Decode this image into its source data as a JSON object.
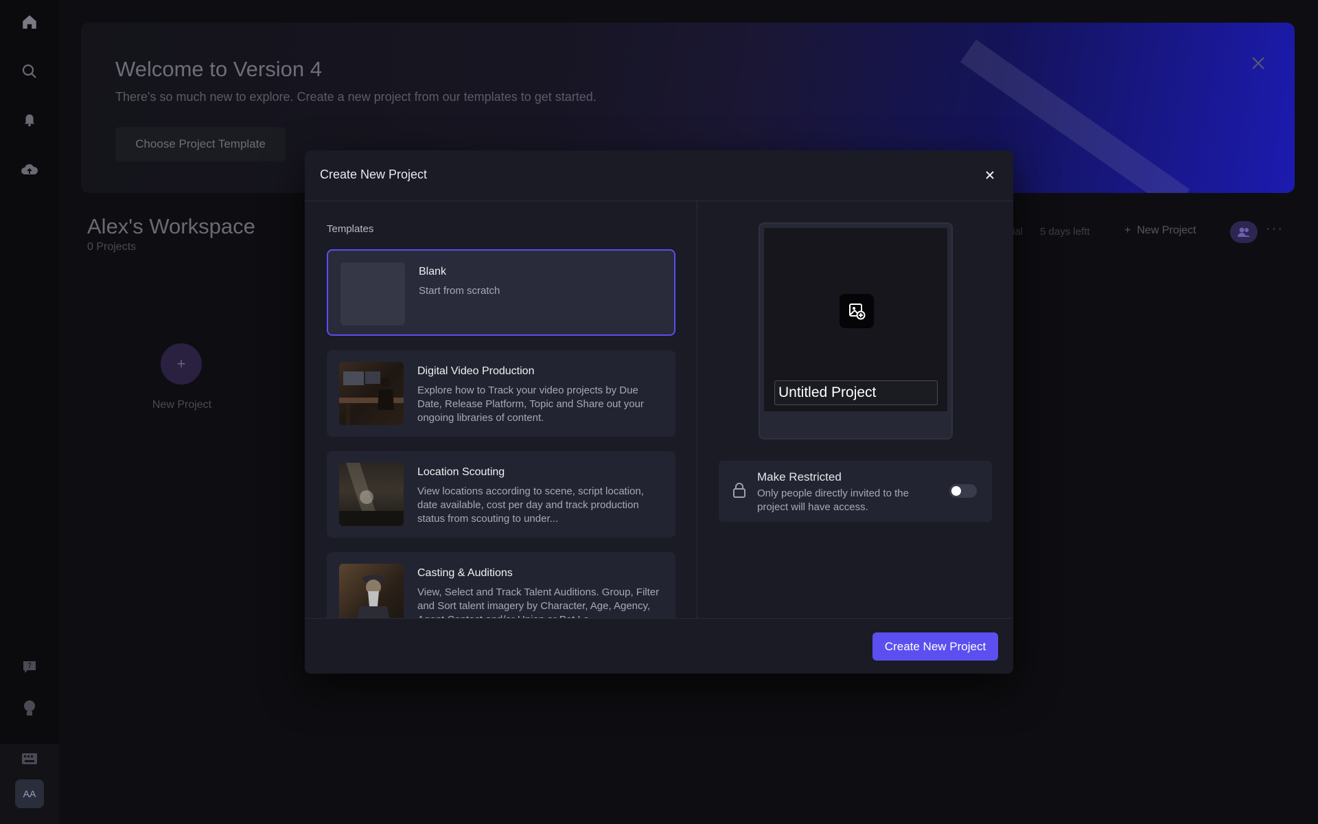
{
  "background": {
    "banner": {
      "title": "Welcome to Version 4",
      "subtitle": "There's so much new to explore. Create a new project from our templates to get started.",
      "button_label": "Choose Project Template"
    },
    "workspace": {
      "title": "Alex's Workspace",
      "project_count": "0 Projects",
      "new_project_label": "New Project"
    },
    "header": {
      "trial_fragment": "ial",
      "days_left": "5 days leftt",
      "new_project_label": "New Project"
    }
  },
  "sidebar": {
    "avatar_initials": "AA"
  },
  "modal": {
    "title": "Create New Project",
    "templates_label": "Templates",
    "templates": [
      {
        "name": "Blank",
        "description": "Start from scratch",
        "selected": true
      },
      {
        "name": "Digital Video Production",
        "description": "Explore how to Track your video projects by Due Date, Release Platform, Topic and Share out your ongoing libraries of content.",
        "selected": false
      },
      {
        "name": "Location Scouting",
        "description": "View locations according to scene, script location, date available, cost per day and track production status from scouting to under...",
        "selected": false
      },
      {
        "name": "Casting & Auditions",
        "description": "View, Select and Track Talent Auditions. Group, Filter and Sort talent imagery by Character, Age, Agency, Agent Contact and/or Union or Pet Lo...",
        "selected": false
      }
    ],
    "project_name_value": "Untitled Project",
    "restrict": {
      "title": "Make Restricted",
      "description": "Only people directly invited to the project will have access.",
      "enabled": false
    },
    "create_button_label": "Create New Project"
  },
  "colors": {
    "accent": "#5b4ff0",
    "modal_bg": "#1a1b25",
    "card_bg": "#232431"
  }
}
